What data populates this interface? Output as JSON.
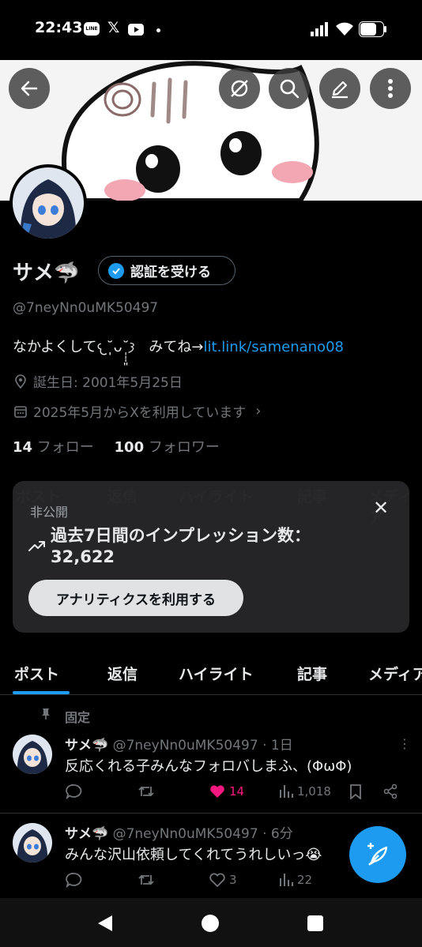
{
  "status": {
    "time": "22:43",
    "left_icons": [
      "line-icon",
      "x-icon",
      "youtube-icon",
      "dot-icon"
    ],
    "right_icons": [
      "signal-icon",
      "wifi-icon",
      "battery-icon"
    ]
  },
  "profile": {
    "name": "サメ🦈",
    "verify_label": "認証を受ける",
    "handle": "@7neyNn0uMK50497",
    "bio_text": "なかよくして𐔌˘̩̩̩ᴗ˘̩̩̩͈𐦯　みてね→",
    "bio_link": "lit.link/samenano08",
    "birthday": "誕生日: 2001年5月25日",
    "joined": "2025年5月からXを利用しています",
    "following_count": "14",
    "following_label": "フォロー",
    "followers_count": "100",
    "followers_label": "フォロワー"
  },
  "card": {
    "private_label": "非公開",
    "title_line1": "過去7日間のインプレッション数：",
    "value": "32,622",
    "cta": "アナリティクスを利用する"
  },
  "tabs": [
    "ポスト",
    "返信",
    "ハイライト",
    "記事",
    "メディア"
  ],
  "pinned_label": "固定",
  "tweets": [
    {
      "name": "サメ🦈",
      "handle": "@7neyNn0uMK50497",
      "time": "· 1日",
      "text": "反応くれる子みんなフォロバしまふ、(ΦωΦ)",
      "likes": "14",
      "views": "1,018"
    },
    {
      "name": "サメ🦈",
      "handle": "@7neyNn0uMK50497",
      "time": "· 6分",
      "text": "みんな沢山依頼してくれてうれしいっ😭",
      "likes": "3",
      "views": "22"
    }
  ],
  "colors": {
    "accent": "#1d9bf0",
    "like": "#f91880",
    "muted": "#71767b"
  }
}
